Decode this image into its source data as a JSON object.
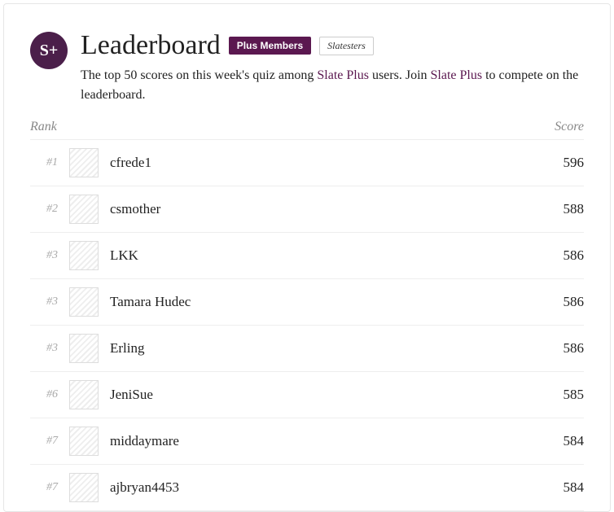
{
  "logo_text": "S+",
  "title": "Leaderboard",
  "badges": {
    "primary": "Plus Members",
    "secondary": "Slatesters"
  },
  "subtitle_parts": {
    "a": "The top 50 scores on this week's quiz among ",
    "b": "Slate Plus",
    "c": " users. Join ",
    "d": "Slate Plus",
    "e": " to compete on the leaderboard."
  },
  "columns": {
    "rank": "Rank",
    "score": "Score"
  },
  "rows": [
    {
      "rank": "#1",
      "name": "cfrede1",
      "score": "596"
    },
    {
      "rank": "#2",
      "name": "csmother",
      "score": "588"
    },
    {
      "rank": "#3",
      "name": "LKK",
      "score": "586"
    },
    {
      "rank": "#3",
      "name": "Tamara Hudec",
      "score": "586"
    },
    {
      "rank": "#3",
      "name": "Erling",
      "score": "586"
    },
    {
      "rank": "#6",
      "name": "JeniSue",
      "score": "585"
    },
    {
      "rank": "#7",
      "name": "middaymare",
      "score": "584"
    },
    {
      "rank": "#7",
      "name": "ajbryan4453",
      "score": "584"
    }
  ]
}
